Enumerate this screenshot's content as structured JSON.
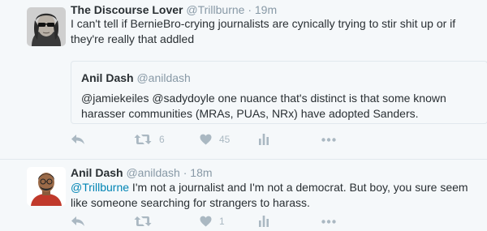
{
  "tweets": [
    {
      "author_name": "The Discourse Lover",
      "author_handle": "@Trillburne",
      "separator": "·",
      "time": "19m",
      "text": "I can't tell if BernieBro-crying journalists are cynically trying to stir shit up or if they're really that addled",
      "quoted": {
        "author_name": "Anil Dash",
        "author_handle": "@anildash",
        "text": "@jamiekeiles @sadydoyle one nuance that's distinct is that some known harasser communities (MRAs, PUAs, NRx) have adopted Sanders."
      },
      "actions": {
        "retweet_count": "6",
        "like_count": "45"
      }
    },
    {
      "author_name": "Anil Dash",
      "author_handle": "@anildash",
      "separator": "·",
      "time": "18m",
      "mention": "@Trillburne",
      "text_rest": " I'm not a journalist and I'm not a democrat. But boy, you sure seem like someone searching for strangers to harass.",
      "actions": {
        "retweet_count": "",
        "like_count": "1"
      }
    }
  ],
  "icons": {
    "reply": "reply-icon",
    "retweet": "retweet-icon",
    "like": "heart-icon",
    "analytics": "analytics-icon",
    "more": "more-icon"
  },
  "colors": {
    "background": "#f5f8fa",
    "text": "#292f33",
    "secondary": "#8899a6",
    "action": "#aab8c2",
    "link": "#0084b4",
    "border": "#e1e8ed"
  }
}
